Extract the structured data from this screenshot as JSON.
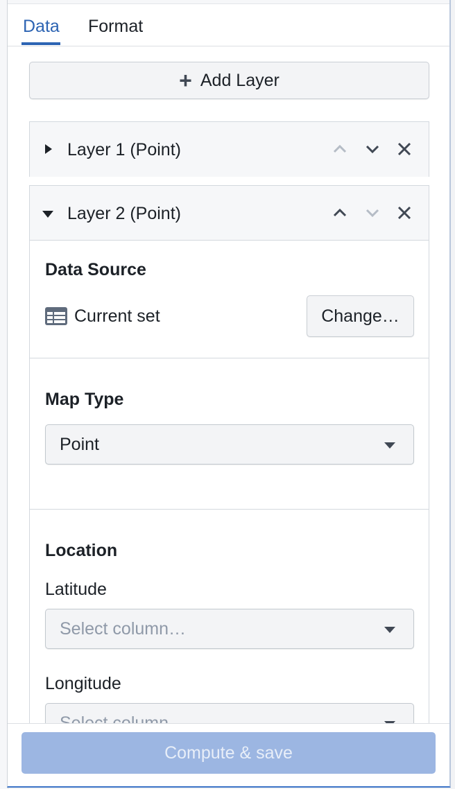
{
  "tabs": [
    {
      "label": "Data",
      "active": true
    },
    {
      "label": "Format",
      "active": false
    }
  ],
  "add_layer": {
    "label": "Add Layer",
    "icon": "plus-icon"
  },
  "layers": [
    {
      "title": "Layer 1 (Point)",
      "expanded": false,
      "move_up_enabled": false,
      "move_down_enabled": true
    },
    {
      "title": "Layer 2 (Point)",
      "expanded": true,
      "move_up_enabled": true,
      "move_down_enabled": false
    }
  ],
  "data_source": {
    "title": "Data Source",
    "current": "Current set",
    "icon": "table-icon",
    "change_label": "Change…"
  },
  "map_type": {
    "title": "Map Type",
    "selected": "Point"
  },
  "location": {
    "title": "Location",
    "latitude_label": "Latitude",
    "latitude_placeholder": "Select column…",
    "longitude_label": "Longitude",
    "longitude_placeholder": "Select column…"
  },
  "footer": {
    "compute_label": "Compute & save",
    "enabled": false
  },
  "colors": {
    "accent": "#2d64b3",
    "compute_disabled": "#9cb6e2"
  }
}
